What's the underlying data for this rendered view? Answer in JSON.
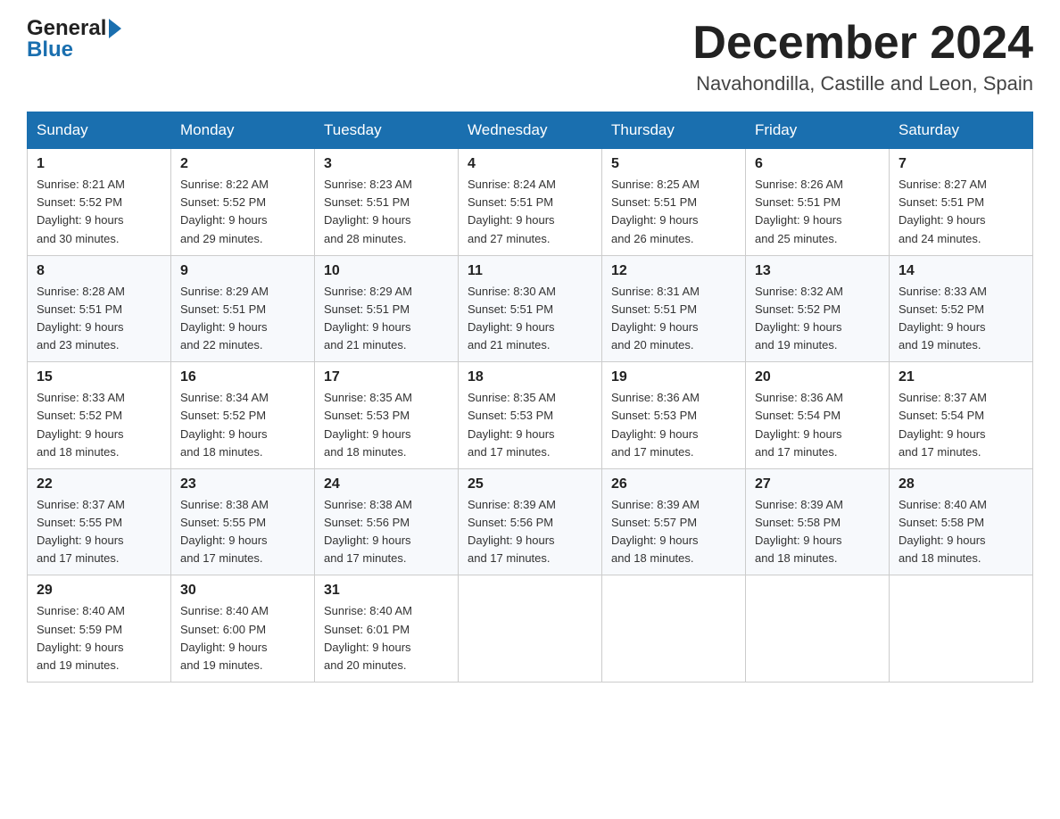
{
  "logo": {
    "part1": "General",
    "part2": "Blue"
  },
  "header": {
    "month": "December 2024",
    "location": "Navahondilla, Castille and Leon, Spain"
  },
  "weekdays": [
    "Sunday",
    "Monday",
    "Tuesday",
    "Wednesday",
    "Thursday",
    "Friday",
    "Saturday"
  ],
  "weeks": [
    [
      {
        "day": "1",
        "sunrise": "8:21 AM",
        "sunset": "5:52 PM",
        "daylight": "9 hours and 30 minutes."
      },
      {
        "day": "2",
        "sunrise": "8:22 AM",
        "sunset": "5:52 PM",
        "daylight": "9 hours and 29 minutes."
      },
      {
        "day": "3",
        "sunrise": "8:23 AM",
        "sunset": "5:51 PM",
        "daylight": "9 hours and 28 minutes."
      },
      {
        "day": "4",
        "sunrise": "8:24 AM",
        "sunset": "5:51 PM",
        "daylight": "9 hours and 27 minutes."
      },
      {
        "day": "5",
        "sunrise": "8:25 AM",
        "sunset": "5:51 PM",
        "daylight": "9 hours and 26 minutes."
      },
      {
        "day": "6",
        "sunrise": "8:26 AM",
        "sunset": "5:51 PM",
        "daylight": "9 hours and 25 minutes."
      },
      {
        "day": "7",
        "sunrise": "8:27 AM",
        "sunset": "5:51 PM",
        "daylight": "9 hours and 24 minutes."
      }
    ],
    [
      {
        "day": "8",
        "sunrise": "8:28 AM",
        "sunset": "5:51 PM",
        "daylight": "9 hours and 23 minutes."
      },
      {
        "day": "9",
        "sunrise": "8:29 AM",
        "sunset": "5:51 PM",
        "daylight": "9 hours and 22 minutes."
      },
      {
        "day": "10",
        "sunrise": "8:29 AM",
        "sunset": "5:51 PM",
        "daylight": "9 hours and 21 minutes."
      },
      {
        "day": "11",
        "sunrise": "8:30 AM",
        "sunset": "5:51 PM",
        "daylight": "9 hours and 21 minutes."
      },
      {
        "day": "12",
        "sunrise": "8:31 AM",
        "sunset": "5:51 PM",
        "daylight": "9 hours and 20 minutes."
      },
      {
        "day": "13",
        "sunrise": "8:32 AM",
        "sunset": "5:52 PM",
        "daylight": "9 hours and 19 minutes."
      },
      {
        "day": "14",
        "sunrise": "8:33 AM",
        "sunset": "5:52 PM",
        "daylight": "9 hours and 19 minutes."
      }
    ],
    [
      {
        "day": "15",
        "sunrise": "8:33 AM",
        "sunset": "5:52 PM",
        "daylight": "9 hours and 18 minutes."
      },
      {
        "day": "16",
        "sunrise": "8:34 AM",
        "sunset": "5:52 PM",
        "daylight": "9 hours and 18 minutes."
      },
      {
        "day": "17",
        "sunrise": "8:35 AM",
        "sunset": "5:53 PM",
        "daylight": "9 hours and 18 minutes."
      },
      {
        "day": "18",
        "sunrise": "8:35 AM",
        "sunset": "5:53 PM",
        "daylight": "9 hours and 17 minutes."
      },
      {
        "day": "19",
        "sunrise": "8:36 AM",
        "sunset": "5:53 PM",
        "daylight": "9 hours and 17 minutes."
      },
      {
        "day": "20",
        "sunrise": "8:36 AM",
        "sunset": "5:54 PM",
        "daylight": "9 hours and 17 minutes."
      },
      {
        "day": "21",
        "sunrise": "8:37 AM",
        "sunset": "5:54 PM",
        "daylight": "9 hours and 17 minutes."
      }
    ],
    [
      {
        "day": "22",
        "sunrise": "8:37 AM",
        "sunset": "5:55 PM",
        "daylight": "9 hours and 17 minutes."
      },
      {
        "day": "23",
        "sunrise": "8:38 AM",
        "sunset": "5:55 PM",
        "daylight": "9 hours and 17 minutes."
      },
      {
        "day": "24",
        "sunrise": "8:38 AM",
        "sunset": "5:56 PM",
        "daylight": "9 hours and 17 minutes."
      },
      {
        "day": "25",
        "sunrise": "8:39 AM",
        "sunset": "5:56 PM",
        "daylight": "9 hours and 17 minutes."
      },
      {
        "day": "26",
        "sunrise": "8:39 AM",
        "sunset": "5:57 PM",
        "daylight": "9 hours and 18 minutes."
      },
      {
        "day": "27",
        "sunrise": "8:39 AM",
        "sunset": "5:58 PM",
        "daylight": "9 hours and 18 minutes."
      },
      {
        "day": "28",
        "sunrise": "8:40 AM",
        "sunset": "5:58 PM",
        "daylight": "9 hours and 18 minutes."
      }
    ],
    [
      {
        "day": "29",
        "sunrise": "8:40 AM",
        "sunset": "5:59 PM",
        "daylight": "9 hours and 19 minutes."
      },
      {
        "day": "30",
        "sunrise": "8:40 AM",
        "sunset": "6:00 PM",
        "daylight": "9 hours and 19 minutes."
      },
      {
        "day": "31",
        "sunrise": "8:40 AM",
        "sunset": "6:01 PM",
        "daylight": "9 hours and 20 minutes."
      },
      null,
      null,
      null,
      null
    ]
  ],
  "labels": {
    "sunrise": "Sunrise:",
    "sunset": "Sunset:",
    "daylight": "Daylight:"
  }
}
